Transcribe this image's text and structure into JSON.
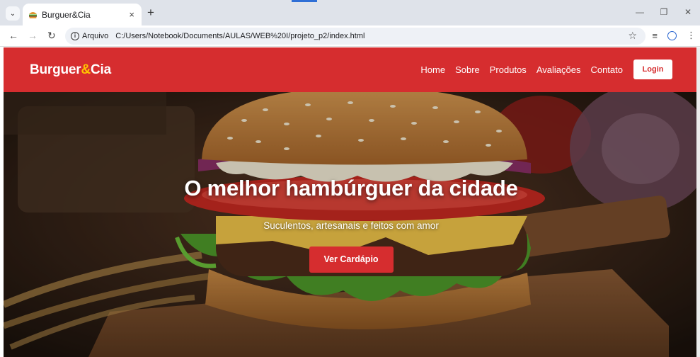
{
  "browser": {
    "tab_title": "Burguer&Cia",
    "tab_favicon": "burger-icon",
    "tab_close": "×",
    "new_tab": "+",
    "security_label": "Arquivo",
    "url": "C:/Users/Notebook/Documents/AULAS/WEB%20I/projeto_p2/index.html"
  },
  "site": {
    "logo_part1": "Burguer",
    "logo_amp": "&",
    "logo_part2": "Cia",
    "nav": [
      "Home",
      "Sobre",
      "Produtos",
      "Avaliações",
      "Contato"
    ],
    "login_label": "Login",
    "brand_color": "#d62d2f",
    "accent_color": "#ffc400"
  },
  "hero": {
    "title": "O melhor hambúrguer da cidade",
    "subtitle": "Suculentos, artesanais e feitos com amor",
    "cta_label": "Ver Cardápio"
  }
}
